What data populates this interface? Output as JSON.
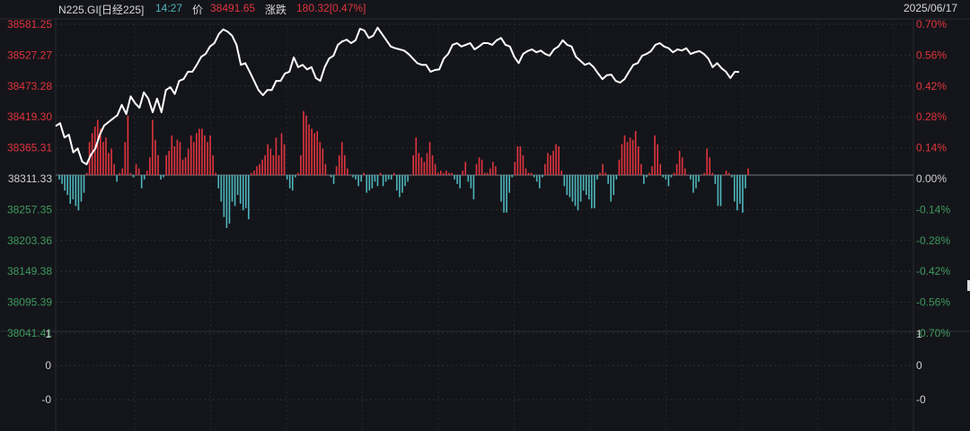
{
  "header": {
    "symbol": "N225.GI[日经225]",
    "time": "14:27",
    "price_label": "价",
    "price": "38491.65",
    "change_label": "涨跌",
    "change": "180.32[0.47%]",
    "date": "2025/06/17"
  },
  "colors": {
    "up": "#e0343e",
    "down": "#4db6bc",
    "line": "#ffffff",
    "neg_label": "#3d9a5e",
    "neutral": "#d0d0d0"
  },
  "chart_data": {
    "type": "line",
    "title": "N225.GI intraday",
    "base_price": 38311.33,
    "price_range": [
      38041.41,
      38581.25
    ],
    "pct_range": [
      -0.7,
      0.7
    ],
    "left_ticks": [
      "38581.25",
      "38527.27",
      "38473.28",
      "38419.30",
      "38365.31",
      "38311.33",
      "38257.35",
      "38203.36",
      "38149.38",
      "38095.39",
      "38041.41"
    ],
    "right_ticks": [
      "0.70%",
      "0.56%",
      "0.42%",
      "0.28%",
      "0.14%",
      "0.00%",
      "-0.14%",
      "-0.28%",
      "-0.42%",
      "-0.56%",
      "-0.70%"
    ],
    "sub_ticks": [
      "1",
      "0",
      "-0"
    ],
    "session_fraction_elapsed": 0.81,
    "prices": [
      38397,
      38402,
      38377,
      38382,
      38351,
      38358,
      38335,
      38330,
      38347,
      38358,
      38382,
      38398,
      38404,
      38410,
      38416,
      38434,
      38418,
      38449,
      38437,
      38429,
      38456,
      38445,
      38421,
      38445,
      38421,
      38460,
      38465,
      38453,
      38476,
      38479,
      38492,
      38492,
      38504,
      38518,
      38523,
      38536,
      38542,
      38558,
      38566,
      38562,
      38555,
      38539,
      38504,
      38507,
      38492,
      38476,
      38460,
      38451,
      38460,
      38460,
      38476,
      38476,
      38489,
      38492,
      38517,
      38500,
      38504,
      38496,
      38500,
      38481,
      38476,
      38500,
      38515,
      38520,
      38539,
      38545,
      38548,
      38542,
      38547,
      38567,
      38564,
      38551,
      38555,
      38569,
      38558,
      38547,
      38536,
      38533,
      38531,
      38529,
      38523,
      38515,
      38507,
      38504,
      38504,
      38492,
      38495,
      38496,
      38515,
      38523,
      38539,
      38542,
      38536,
      38539,
      38542,
      38531,
      38536,
      38542,
      38542,
      38539,
      38547,
      38551,
      38539,
      38536,
      38518,
      38507,
      38523,
      38528,
      38531,
      38526,
      38529,
      38523,
      38520,
      38531,
      38536,
      38547,
      38539,
      38536,
      38518,
      38511,
      38504,
      38507,
      38500,
      38489,
      38479,
      38486,
      38487,
      38476,
      38473,
      38479,
      38492,
      38504,
      38507,
      38520,
      38523,
      38528,
      38539,
      38542,
      38536,
      38533,
      38526,
      38531,
      38529,
      38533,
      38523,
      38526,
      38528,
      38523,
      38515,
      38500,
      38507,
      38498,
      38492,
      38481,
      38492,
      38491.65
    ],
    "bars_pct": [
      -0.02,
      -0.04,
      -0.07,
      -0.09,
      -0.13,
      -0.11,
      -0.14,
      -0.16,
      -0.12,
      -0.08,
      0.01,
      0.15,
      0.19,
      0.22,
      0.25,
      0.21,
      0.15,
      0.17,
      0.1,
      0.12,
      0.05,
      -0.03,
      0.01,
      0.03,
      0.15,
      0.27,
      0.01,
      -0.01,
      0.05,
      0.03,
      -0.06,
      -0.02,
      0.02,
      0.08,
      0.25,
      0.16,
      0.09,
      -0.02,
      -0.01,
      0.09,
      0.11,
      0.18,
      0.13,
      0.16,
      0.15,
      0.07,
      0.08,
      0.12,
      0.18,
      0.15,
      0.19,
      0.21,
      0.21,
      0.18,
      0.15,
      0.18,
      0.09,
      0.01,
      -0.06,
      -0.12,
      -0.19,
      -0.24,
      -0.22,
      -0.12,
      -0.14,
      -0.09,
      -0.13,
      -0.16,
      -0.15,
      -0.2,
      0.01,
      0.02,
      0.04,
      0.05,
      0.07,
      0.09,
      0.14,
      0.12,
      0.09,
      0.17,
      0.09,
      0.19,
      0.14,
      -0.02,
      -0.06,
      -0.07,
      -0.01,
      0.01,
      0.09,
      0.29,
      0.27,
      0.23,
      0.21,
      0.19,
      0.2,
      0.15,
      0.12,
      0.05,
      0.0,
      -0.01,
      -0.04,
      0.04,
      0.09,
      0.15,
      0.09,
      0.03,
      0.0,
      -0.01,
      -0.02,
      -0.05,
      -0.03,
      0.01,
      -0.08,
      -0.07,
      -0.06,
      -0.03,
      -0.05,
      0.01,
      -0.05,
      -0.03,
      -0.02,
      -0.02,
      0.01,
      -0.07,
      -0.1,
      -0.08,
      -0.05,
      -0.03,
      0.0,
      0.09,
      0.17,
      0.1,
      0.08,
      0.06,
      0.1,
      0.15,
      0.09,
      0.05,
      0.01,
      0.02,
      0.01,
      0.02,
      0.01,
      0.01,
      -0.02,
      -0.04,
      -0.06,
      0.02,
      0.06,
      -0.03,
      -0.06,
      -0.11,
      0.05,
      0.08,
      0.07,
      0.01,
      0.01,
      0.03,
      0.06,
      0.04,
      0.0,
      -0.12,
      -0.17,
      -0.17,
      -0.08,
      -0.01,
      0.06,
      0.13,
      0.13,
      0.09,
      0.03,
      0.01,
      0.01,
      -0.01,
      -0.03,
      -0.06,
      -0.01,
      0.05,
      0.1,
      0.09,
      0.11,
      0.14,
      0.13,
      0.02,
      -0.05,
      -0.09,
      -0.1,
      -0.12,
      -0.14,
      -0.16,
      -0.12,
      -0.07,
      -0.09,
      -0.11,
      -0.15,
      -0.15,
      -0.02,
      0.01,
      0.05,
      0.01,
      -0.04,
      -0.12,
      -0.09,
      -0.02,
      0.07,
      0.14,
      0.18,
      0.15,
      0.17,
      0.16,
      0.2,
      0.13,
      0.05,
      -0.04,
      -0.01,
      0.01,
      0.04,
      0.18,
      0.14,
      0.05,
      -0.01,
      -0.02,
      -0.05,
      -0.01,
      0.01,
      0.05,
      0.11,
      0.08,
      0.03,
      0.0,
      -0.02,
      -0.08,
      -0.06,
      -0.03,
      0.0,
      0.01,
      0.12,
      0.08,
      0.01,
      -0.04,
      -0.14,
      -0.14,
      0.0,
      0.02,
      0.01,
      -0.01,
      -0.12,
      -0.16,
      -0.13,
      -0.17,
      -0.06,
      0.03
    ]
  }
}
